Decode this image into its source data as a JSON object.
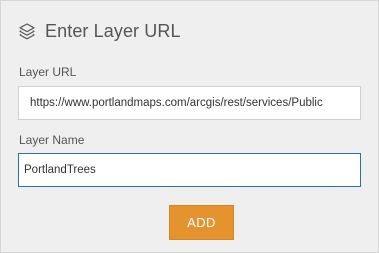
{
  "dialog": {
    "title": "Enter Layer URL",
    "icon": "layers-icon",
    "url_label": "Layer URL",
    "url_value": "https://www.portlandmaps.com/arcgis/rest/services/Public",
    "name_label": "Layer Name",
    "name_value": "PortlandTrees",
    "add_label": "ADD"
  },
  "colors": {
    "panel_bg": "#efefef",
    "accent_button": "#e4932f",
    "focus_border": "#2f6fa8"
  }
}
